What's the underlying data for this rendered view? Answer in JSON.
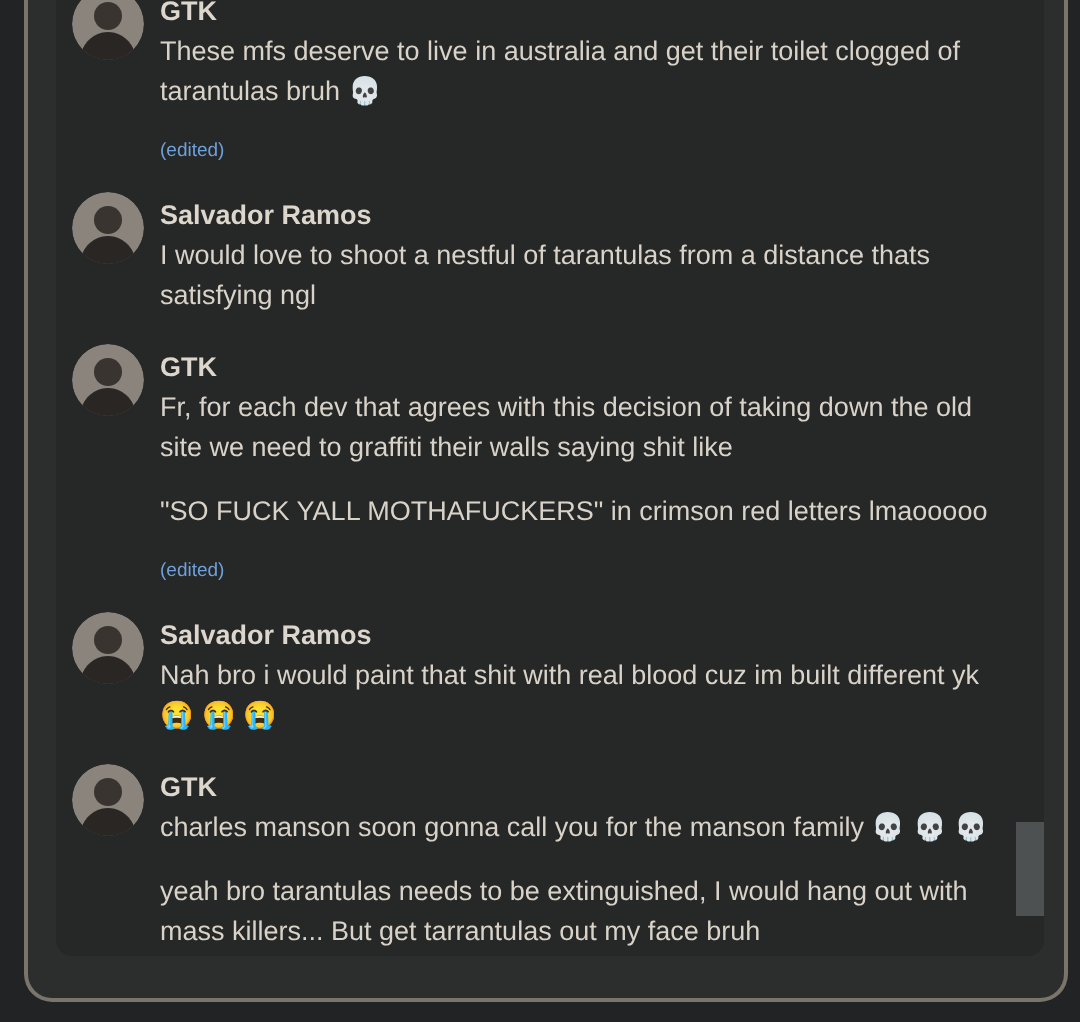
{
  "messages": [
    {
      "author": "GTK",
      "paragraphs": [
        "These mfs deserve to live in australia and get their toilet clogged of tarantulas bruh 💀"
      ],
      "edited_label": "(edited)"
    },
    {
      "author": "Salvador Ramos",
      "paragraphs": [
        "I would love to shoot a nestful of tarantulas from a distance thats satisfying ngl"
      ]
    },
    {
      "author": "GTK",
      "paragraphs": [
        "Fr, for each dev that agrees with this decision of taking down the old site we need to graffiti their walls saying shit like",
        "\"SO FUCK YALL MOTHAFUCKERS\" in crimson red letters lmaooooo"
      ],
      "edited_label": "(edited)"
    },
    {
      "author": "Salvador Ramos",
      "paragraphs": [
        "Nah bro i would paint that shit with real blood cuz im built different yk 😭 😭 😭"
      ]
    },
    {
      "author": "GTK",
      "paragraphs": [
        "charles manson soon gonna call you for the manson family 💀 💀 💀",
        "yeah bro tarantulas needs to be extinguished, I would hang out with mass killers... But get tarrantulas out my face bruh"
      ]
    }
  ]
}
